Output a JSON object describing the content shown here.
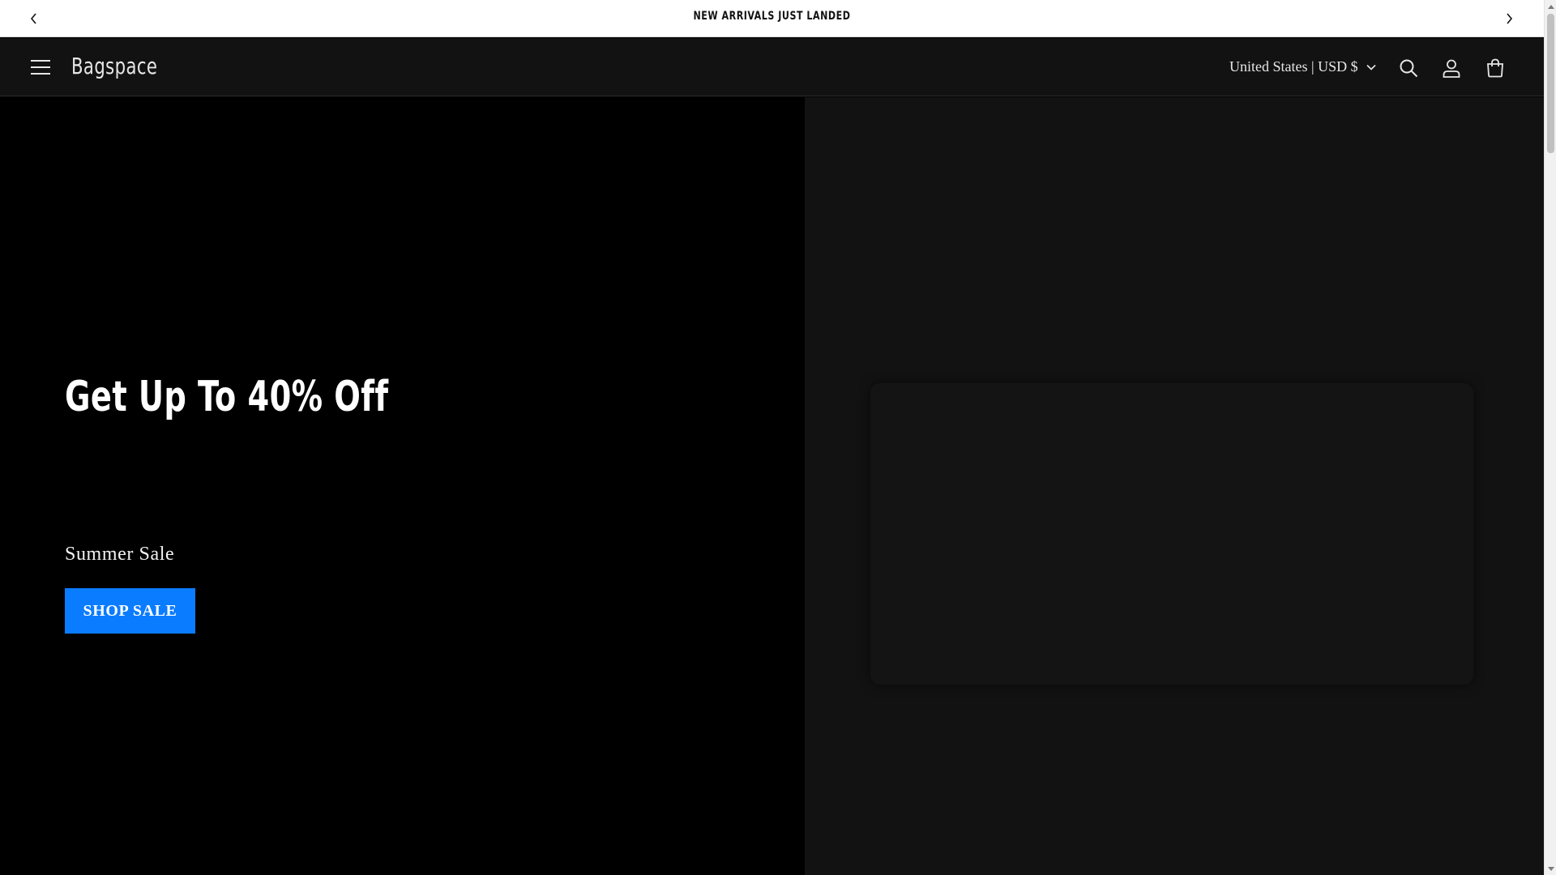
{
  "announcement": {
    "text": "NEW ARRIVALS JUST LANDED",
    "prev_icon": "chevron-left-icon",
    "next_icon": "chevron-right-icon"
  },
  "header": {
    "menu_icon": "hamburger-menu-icon",
    "logo": "Bagspace",
    "country_selector": "United States | USD $",
    "country_icon": "chevron-down-icon",
    "search_icon": "search-icon",
    "account_icon": "account-icon",
    "cart_icon": "cart-icon"
  },
  "hero": {
    "title": "Get Up To 40% Off",
    "subtitle": "Summer Sale",
    "button_label": "SHOP SALE"
  },
  "colors": {
    "announcement_bg": "#ffffff",
    "header_bg": "#121212",
    "hero_left_bg": "#000000",
    "hero_right_bg": "#121212",
    "button_bg": "#0a7cff",
    "text_light": "#ffffff"
  }
}
